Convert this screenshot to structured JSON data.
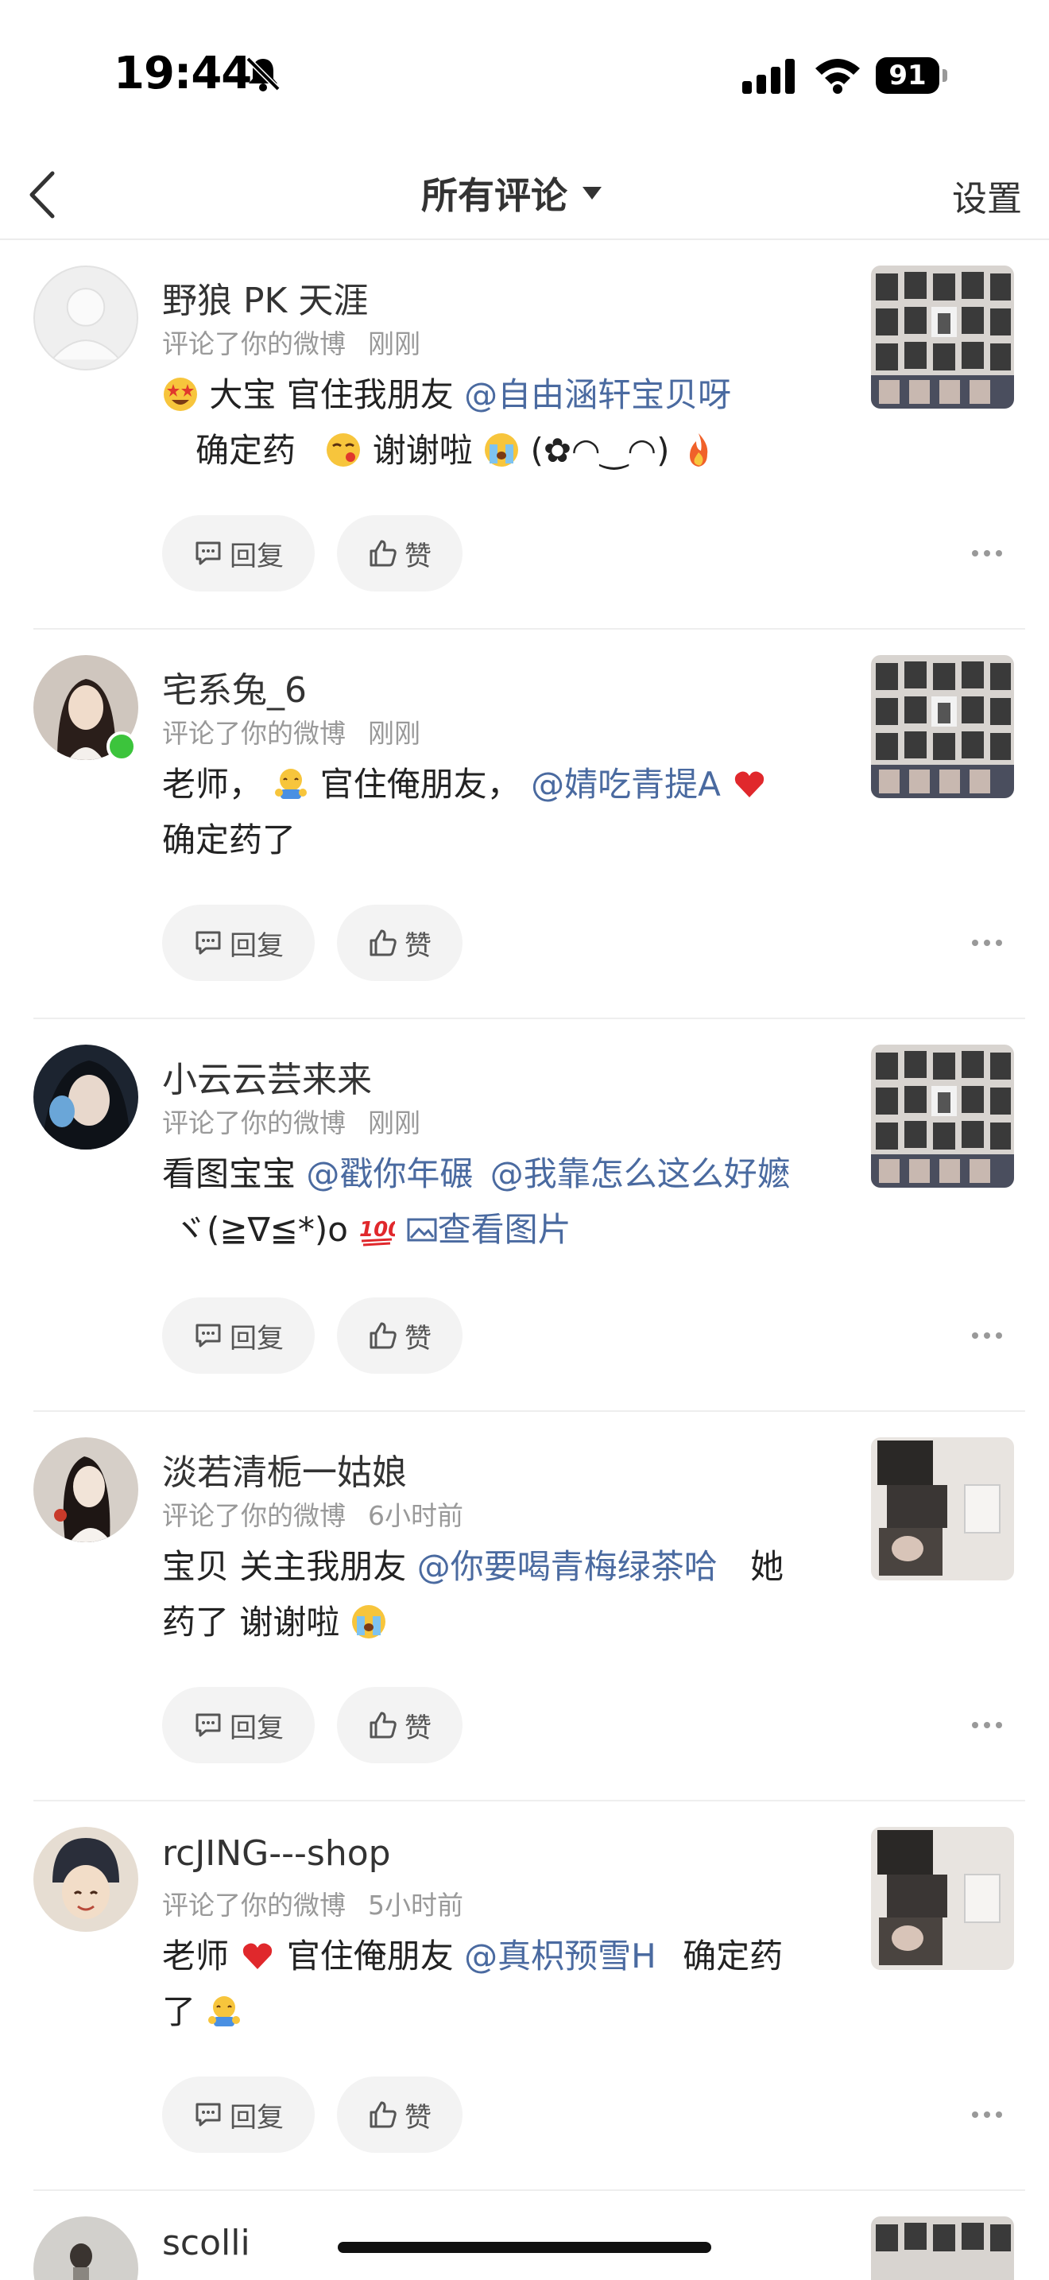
{
  "status_bar": {
    "time": "19:44",
    "battery": "91"
  },
  "nav": {
    "title": "所有评论",
    "settings": "设置"
  },
  "buttons": {
    "reply": "回复",
    "like": "赞"
  },
  "comments": [
    {
      "username": "野狼 PK 天涯",
      "action": "评论了你的微博",
      "time": "刚刚",
      "line1_text": "大宝  官住我朋友",
      "line1_mention": "@自由涵轩宝贝呀",
      "line2_text1": "确定药",
      "line2_text2": "谢谢啦",
      "line2_kaomoji": "(✿◠‿◠)"
    },
    {
      "username": "宅系兔_6",
      "action": "评论了你的微博",
      "time": "刚刚",
      "line1_text1": "老师，",
      "line1_text2": "官住俺朋友，",
      "line1_mention": "@婧吃青提A",
      "line2_text": "确定药了"
    },
    {
      "username": "小云云芸来来",
      "action": "评论了你的微博",
      "time": "刚刚",
      "line1_text": "看图宝宝",
      "line1_mention1": "@戳你年碾",
      "line1_mention2": "@我靠怎么这么好嬷",
      "line2_kaomoji": "ヾ(≧∇≦*)o",
      "line2_link": "查看图片"
    },
    {
      "username": "淡若清栀一姑娘",
      "action": "评论了你的微博",
      "time": "6小时前",
      "line1_text1": "宝贝 关主我朋友",
      "line1_mention": "@你要喝青梅绿茶哈",
      "line1_text2": "她",
      "line2_text": "药了 谢谢啦"
    },
    {
      "username": "rcJING---shop",
      "action": "评论了你的微博",
      "time": "5小时前",
      "line1_text1": "老师",
      "line1_text2": "官住俺朋友",
      "line1_mention": "@真枳预雪H",
      "line1_text3": "确定药",
      "line2_text": "了"
    },
    {
      "username": "scolli"
    }
  ],
  "colors": {
    "mention": "#4a6aa0",
    "online": "#3cc43c",
    "meta": "#999999"
  },
  "icons": [
    "bell-slash-icon",
    "signal-icon",
    "wifi-icon",
    "battery-icon",
    "back-arrow-icon",
    "caret-down-icon",
    "comment-icon",
    "thumbs-up-icon",
    "more-dots-icon"
  ]
}
